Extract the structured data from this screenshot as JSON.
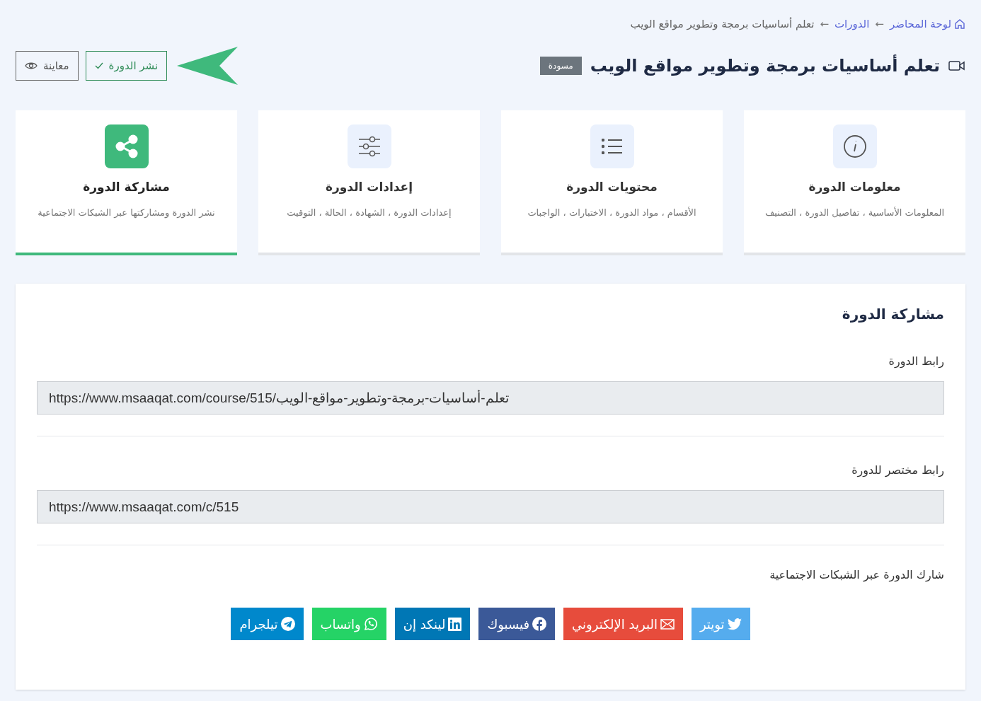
{
  "breadcrumb": [
    {
      "kind": "home",
      "text": "لوحة المحاضر"
    },
    {
      "kind": "sep",
      "text": "←"
    },
    {
      "kind": "link",
      "text": "الدورات"
    },
    {
      "kind": "sep",
      "text": "←"
    },
    {
      "kind": "current",
      "text": "تعلم أساسيات برمجة وتطوير مواقع الويب"
    }
  ],
  "header": {
    "title": "تعلم أساسيات برمجة وتطوير مواقع الويب",
    "badge": "مسودة",
    "buttons": [
      {
        "kind": "publish",
        "label": "نشر الدورة"
      },
      {
        "kind": "preview",
        "label": "معاينة"
      }
    ]
  },
  "steps": [
    {
      "kind": "info",
      "title": "معلومات الدورة",
      "description": "المعلومات الأساسية ، تفاصيل الدورة ، التصنيف",
      "selected": false
    },
    {
      "kind": "list",
      "title": "محتويات الدورة",
      "description": "الأقسام ، مواد الدورة ، الاختبارات ، الواجبات",
      "selected": false
    },
    {
      "kind": "settings",
      "title": "إعدادات الدورة",
      "description": "إعدادات الدورة ، الشهادة ، الحالة ، التوقيت",
      "selected": false
    },
    {
      "kind": "share",
      "title": "مشاركة الدورة",
      "description": "نشر الدورة ومشاركتها عبر الشبكات الاجتماعية",
      "selected": true
    }
  ],
  "panel": {
    "title": "مشاركة الدورة",
    "fields": [
      {
        "label": "رابط الدورة",
        "value": "https://www.msaaqat.com/course/515/تعلم-أساسيات-برمجة-وتطوير-مواقع-الويب"
      },
      {
        "label": "رابط مختصر للدورة",
        "value": "https://www.msaaqat.com/c/515"
      }
    ],
    "share_label": "شارك الدورة عبر الشبكات الاجتماعية",
    "share_buttons": [
      {
        "kind": "twitter",
        "label": "تويتر",
        "color": "#55acee"
      },
      {
        "kind": "email",
        "label": "البريد الإلكتروني",
        "color": "#e74c3c"
      },
      {
        "kind": "facebook",
        "label": "فيسبوك",
        "color": "#3b5998"
      },
      {
        "kind": "linkedin",
        "label": "لينكد إن",
        "color": "#0077b5"
      },
      {
        "kind": "whatsapp",
        "label": "واتساب",
        "color": "#25d366"
      },
      {
        "kind": "telegram",
        "label": "تيلجرام",
        "color": "#0088cc"
      }
    ]
  }
}
